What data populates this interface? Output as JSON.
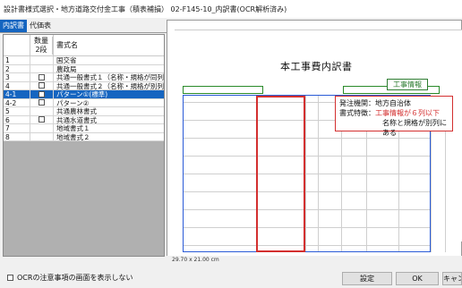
{
  "window": {
    "title": "設計書様式選択・地方道路交付金工事（積表補損） 02-F145-10_内訳書(OCR解析済み)"
  },
  "tabs": [
    {
      "label": "内訳書",
      "active": true
    },
    {
      "label": "代価表",
      "active": false
    }
  ],
  "table": {
    "headers": {
      "no": "",
      "qty": "数量\n2段",
      "name": "書式名"
    },
    "qty_header_line1": "数量",
    "qty_header_line2": "2段",
    "rows": [
      {
        "no": "1",
        "checkbox": false,
        "name": "国交省",
        "selected": false
      },
      {
        "no": "2",
        "checkbox": false,
        "name": "農政局",
        "selected": false
      },
      {
        "no": "3",
        "checkbox": true,
        "name": "共通一般書式１（名称・規格が同列）",
        "selected": false
      },
      {
        "no": "4",
        "checkbox": true,
        "name": "共通一般書式２（名称・規格が別列）",
        "selected": false
      },
      {
        "no": "4-1",
        "checkbox": true,
        "name": "パターン①(標準)",
        "selected": true
      },
      {
        "no": "4-2",
        "checkbox": true,
        "name": "パターン②",
        "selected": false
      },
      {
        "no": "5",
        "checkbox": false,
        "name": "共通農林書式",
        "selected": false
      },
      {
        "no": "6",
        "checkbox": true,
        "name": "共通水道書式",
        "selected": false
      },
      {
        "no": "7",
        "checkbox": false,
        "name": "地域書式１",
        "selected": false
      },
      {
        "no": "8",
        "checkbox": false,
        "name": "地域書式２",
        "selected": false
      }
    ]
  },
  "document": {
    "title": "本工事費内訳書",
    "status_size": "29.70 x 21.00 cm"
  },
  "callouts": {
    "green": "工事情報",
    "red_line1": "発注機関：地方自治体",
    "red_line2_prefix": "書式特徴：",
    "red_line2_highlight": "工事情報が６列以下",
    "red_line3": "名称と規格が別列にある"
  },
  "footer": {
    "ocr_notice_label": "OCRの注意事項の画面を表示しない",
    "settings_button": "設定",
    "ok_button": "OK",
    "cancel_button": "キャンセル"
  },
  "colors": {
    "accent": "#1565c0",
    "red": "#d32f2f",
    "green": "#2e7d32",
    "blue_box": "#2a5bd7"
  }
}
